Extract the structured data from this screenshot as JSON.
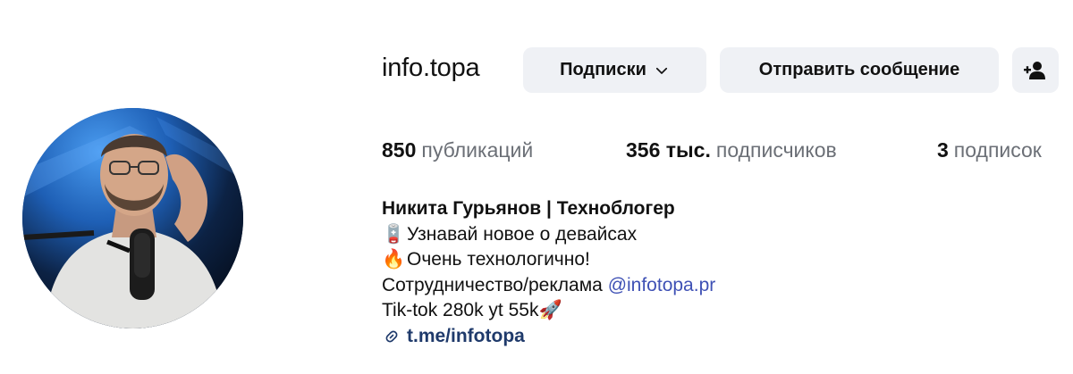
{
  "profile": {
    "username": "info.topa",
    "follow_label": "Подписки",
    "message_label": "Отправить сообщение",
    "add_user_icon": "person-plus-icon"
  },
  "stats": {
    "posts_count": "850",
    "posts_label": "публикаций",
    "followers_count": "356 тыс.",
    "followers_label": "подписчиков",
    "following_count": "3",
    "following_label": "подписок"
  },
  "bio": {
    "name": "Никита Гурьянов | Техноблогер",
    "line1_emoji": "🪫",
    "line1_text": "Узнавай новое о девайсах",
    "line2_emoji": "🔥",
    "line2_text": "Очень технологично!",
    "line3_text": "Сотрудничество/реклама",
    "line3_mention": "@infotopa.pr",
    "line4_text": "Tik-tok 280k yt 55k",
    "line4_emoji": "🚀",
    "link_text": "t.me/infotopa"
  },
  "colors": {
    "button_bg": "#eff1f5",
    "mention": "#3f51b5",
    "link": "#1f3a6b",
    "secondary_text": "#6b6f76"
  }
}
